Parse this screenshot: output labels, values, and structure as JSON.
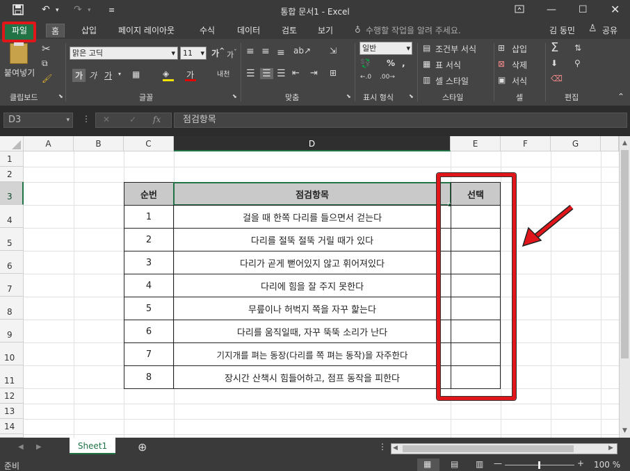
{
  "titlebar": {
    "title": "통합 문서1 - Excel",
    "icons": [
      "save-icon",
      "undo-icon",
      "redo-icon",
      "customize-icon",
      "ribbon-display-icon",
      "minimize-icon",
      "maximize-icon",
      "close-icon"
    ]
  },
  "tabs": [
    {
      "label": "파일"
    },
    {
      "label": "홈"
    },
    {
      "label": "삽입"
    },
    {
      "label": "페이지 레이아웃"
    },
    {
      "label": "수식"
    },
    {
      "label": "데이터"
    },
    {
      "label": "검토"
    },
    {
      "label": "보기"
    }
  ],
  "tellme": "수행할 작업을 알려 주세요.",
  "user": "김 동민",
  "share": "공유",
  "ribbon": {
    "paste": "붙여넣기",
    "font_name": "맑은 고딕",
    "font_size": "11",
    "number_format": "일반",
    "conditional": "조건부 서식",
    "table_format": "표 서식",
    "cell_style": "셀 스타일",
    "insert": "삽입",
    "delete": "삭제",
    "format": "서식",
    "groups": {
      "clipboard": "클립보드",
      "font": "글꼴",
      "align": "맞춤",
      "number": "표시 형식",
      "styles": "스타일",
      "cells": "셀",
      "edit": "편집"
    }
  },
  "formula_bar": {
    "name_box": "D3",
    "content": "점검항목",
    "fx": "fx"
  },
  "columns": [
    "A",
    "B",
    "C",
    "D",
    "E",
    "F",
    "G"
  ],
  "rows": [
    "1",
    "2",
    "3",
    "4",
    "5",
    "6",
    "7",
    "8",
    "9",
    "10",
    "11",
    "12",
    "13",
    "14"
  ],
  "table": {
    "headers": [
      "순번",
      "점검항목",
      "선택"
    ],
    "rows": [
      {
        "no": "1",
        "item": "걸을 때 한쪽 다리를 들으면서 걷는다"
      },
      {
        "no": "2",
        "item": "다리를 절뚝 절뚝 거릴 때가 있다"
      },
      {
        "no": "3",
        "item": "다리가 곧게 뻗어있지 않고 휘어져있다"
      },
      {
        "no": "4",
        "item": "다리에 힘을 잘 주지 못한다"
      },
      {
        "no": "5",
        "item": "무릎이나 허벅지 쪽을 자꾸 핥는다"
      },
      {
        "no": "6",
        "item": "다리를 움직일때, 자꾸 뚝뚝 소리가 난다"
      },
      {
        "no": "7",
        "item": "기지개를 펴는 동장(다리를 쪽 펴는 동작)을 자주한다"
      },
      {
        "no": "8",
        "item": "장시간 산책시 힘들어하고, 점프 동작을 피한다"
      }
    ]
  },
  "sheet_tab": "Sheet1",
  "status": {
    "ready": "준비",
    "zoom": "100 %"
  },
  "colors": {
    "accent_green": "#217346",
    "highlight_red": "#e0161b",
    "header_fill": "#c9c9c9"
  }
}
